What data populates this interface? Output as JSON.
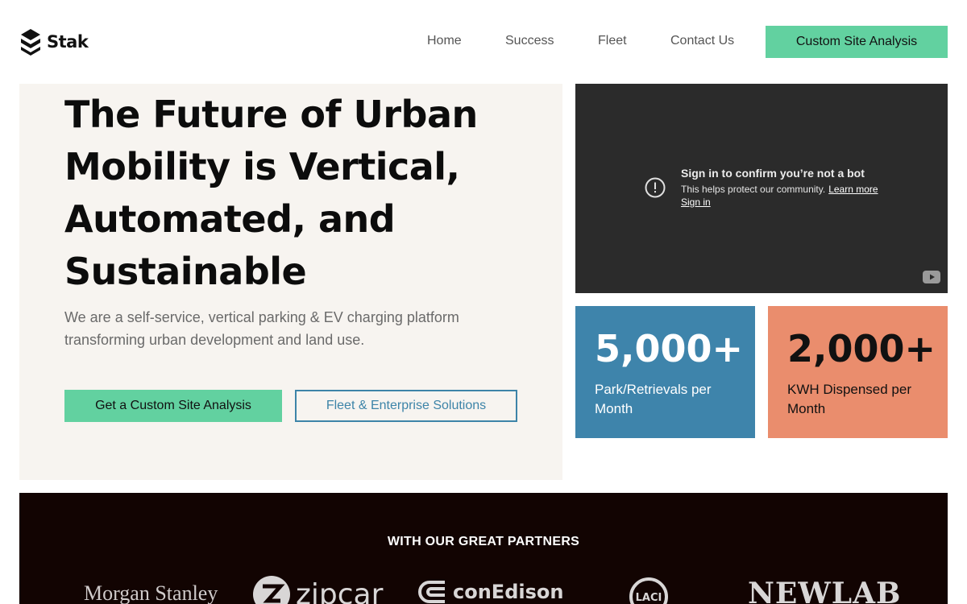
{
  "header": {
    "logo_text": "Stak",
    "nav": [
      {
        "label": "Home"
      },
      {
        "label": "Success"
      },
      {
        "label": "Fleet"
      },
      {
        "label": "Contact Us"
      }
    ],
    "cta_label": "Custom Site Analysis"
  },
  "hero": {
    "title": "The Future of Urban Mobility is Vertical, Automated, and Sustainable",
    "subtitle": "We are a self-service, vertical parking & EV charging platform transforming urban development and land use.",
    "primary_button": "Get a Custom Site Analysis",
    "secondary_button": "Fleet & Enterprise Solutions"
  },
  "video": {
    "title": "Sign in to confirm you’re not a bot",
    "description": "This helps protect our community.",
    "learn_more": "Learn more",
    "sign_in": "Sign in",
    "icons": [
      "alert-circle-icon",
      "youtube-icon"
    ]
  },
  "stats": [
    {
      "value": "5,000+",
      "label": "Park/Retrievals per Month",
      "color": "#3e84ab"
    },
    {
      "value": "2,000+",
      "label": "KWH Dispensed per Month",
      "color": "#ea8d6d"
    }
  ],
  "partners": {
    "title": "WITH OUR GREAT PARTNERS",
    "logos": [
      {
        "name": "Morgan Stanley"
      },
      {
        "name": "zipcar"
      },
      {
        "name": "conEdison"
      },
      {
        "name": "LACI"
      },
      {
        "name": "NEWLAB"
      }
    ]
  },
  "colors": {
    "accent_green": "#62d1a0",
    "accent_blue": "#3e84ab",
    "accent_orange": "#ea8d6d",
    "hero_bg": "#f7f4f0",
    "partners_bg": "#120402"
  }
}
